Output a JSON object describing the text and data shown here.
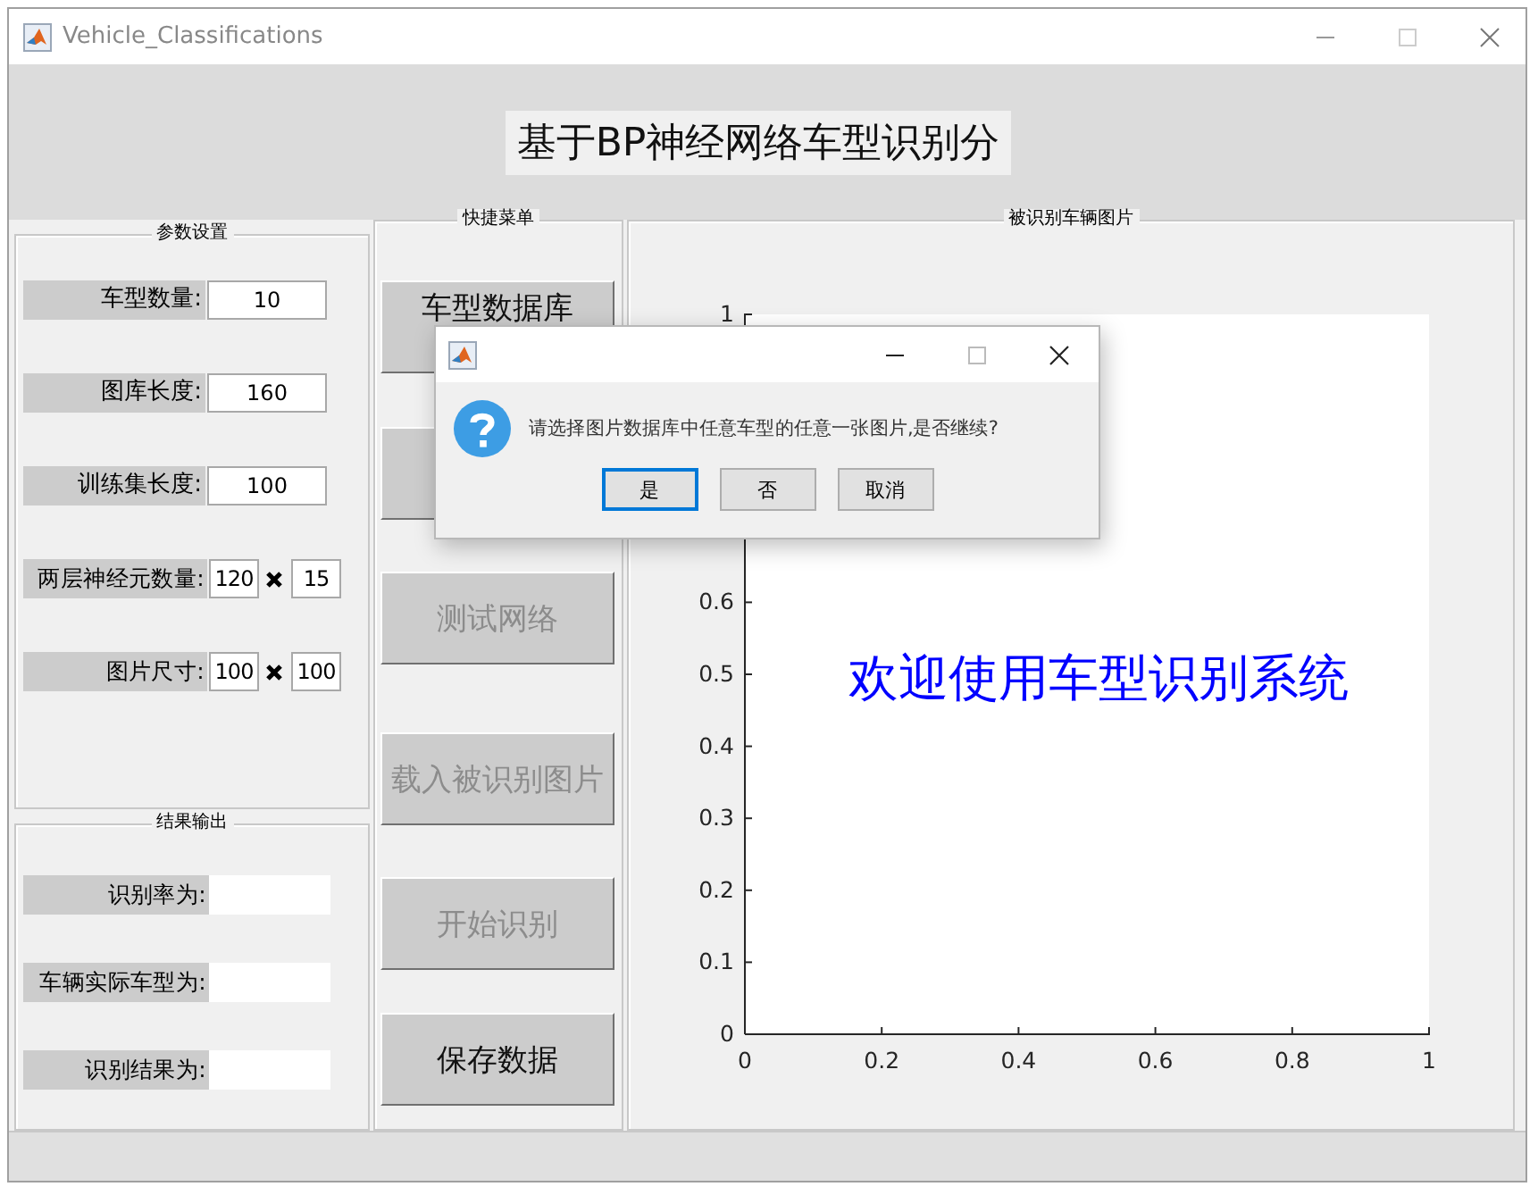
{
  "window": {
    "title": "Vehicle_Classifications"
  },
  "header": {
    "title": "基于BP神经网络车型识别分"
  },
  "parameters": {
    "title": "参数设置",
    "rows": [
      {
        "kind": "single",
        "label": "车型数量:",
        "values": [
          "10"
        ]
      },
      {
        "kind": "single",
        "label": "图库长度:",
        "values": [
          "160"
        ]
      },
      {
        "kind": "single",
        "label": "训练集长度:",
        "values": [
          "100"
        ]
      },
      {
        "kind": "pair",
        "label": "两层神经元数量:",
        "values": [
          "120",
          "15"
        ]
      },
      {
        "kind": "pair",
        "label": "图片尺寸:",
        "values": [
          "100",
          "100"
        ]
      }
    ]
  },
  "results": {
    "title": "结果输出",
    "rows": [
      {
        "label": "识别率为:"
      },
      {
        "label": "车辆实际车型为:"
      },
      {
        "label": "识别结果为:"
      }
    ]
  },
  "menu": {
    "title": "快捷菜单",
    "buttons": [
      {
        "kind": "button",
        "label": "车型数据库",
        "disabled": false
      },
      {
        "kind": "covered"
      },
      {
        "kind": "button",
        "label": "测试网络",
        "disabled": true
      },
      {
        "kind": "button",
        "label": "载入被识别图片",
        "disabled": true
      },
      {
        "kind": "button",
        "label": "开始识别",
        "disabled": true
      },
      {
        "kind": "button",
        "label": "保存数据",
        "disabled": false
      }
    ]
  },
  "image_panel": {
    "title": "被识别车辆图片",
    "welcome_text": "欢迎使用车型识别系统",
    "y_ticks": [
      "1",
      "0.6",
      "0.5",
      "0.4",
      "0.3",
      "0.2",
      "0.1",
      "0"
    ],
    "x_ticks": [
      "0",
      "0.2",
      "0.4",
      "0.6",
      "0.8",
      "1"
    ]
  },
  "dialog": {
    "message": "请选择图片数据库中任意车型的任意一张图片,是否继续?",
    "buttons": [
      {
        "label": "是",
        "selected": true
      },
      {
        "label": "否",
        "selected": false
      },
      {
        "label": "取消",
        "selected": false
      }
    ]
  }
}
